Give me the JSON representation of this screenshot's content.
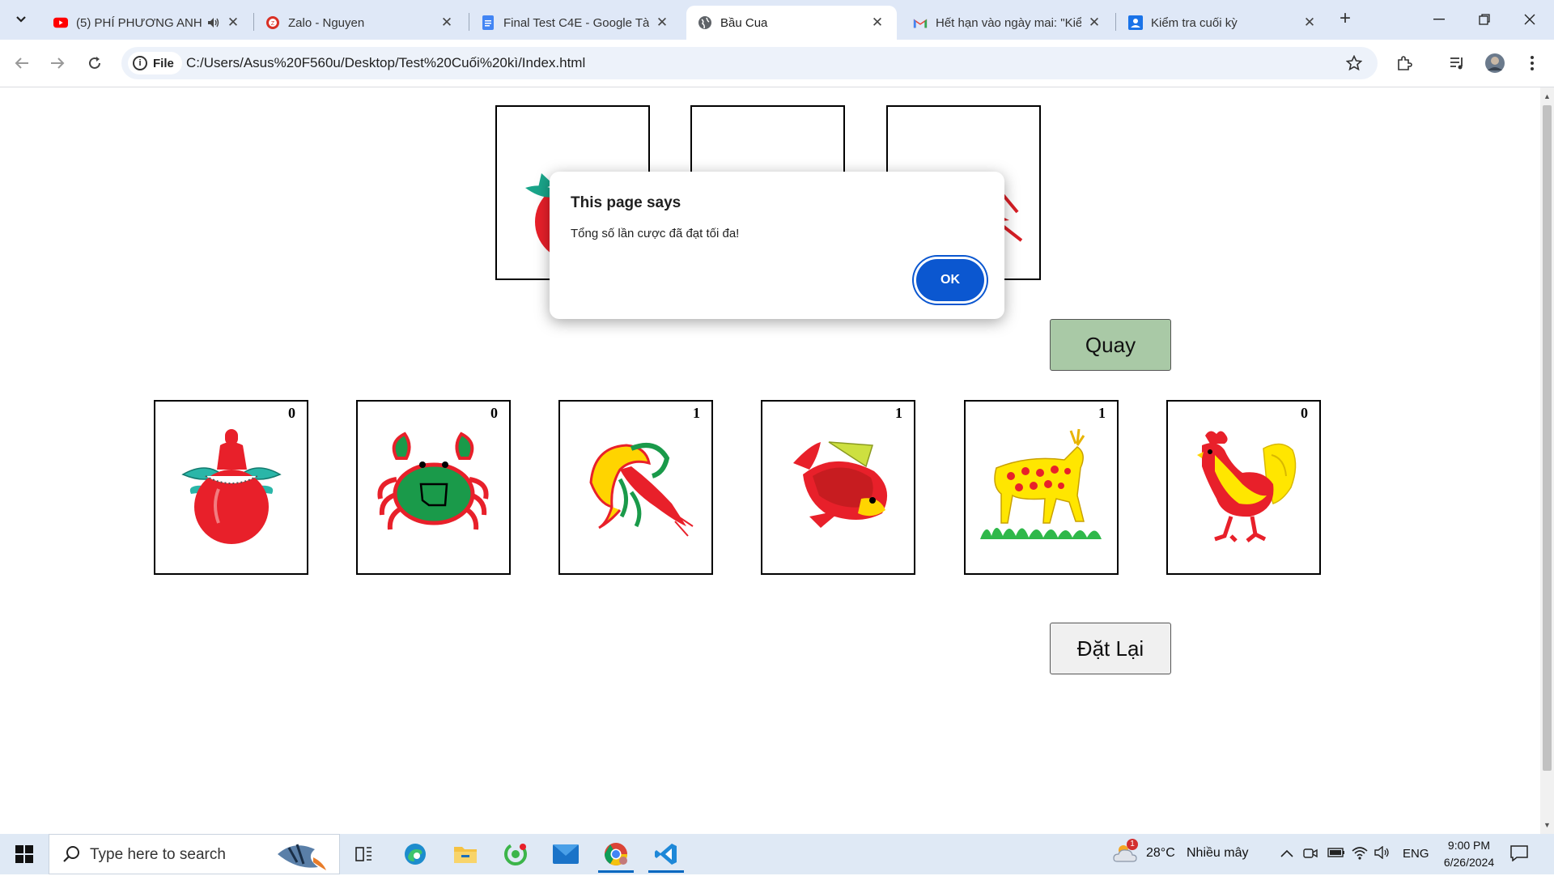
{
  "browser": {
    "tabs": [
      {
        "title": "(5) PHÍ PHƯƠNG ANH",
        "icon": "youtube-icon",
        "audio": true,
        "active": false
      },
      {
        "title": "Zalo - Nguyen",
        "icon": "zalo-icon",
        "active": false
      },
      {
        "title": "Final Test C4E - Google Tài",
        "icon": "google-docs-icon",
        "active": false
      },
      {
        "title": "Bầu Cua",
        "icon": "globe-icon",
        "active": true
      },
      {
        "title": "Hết hạn vào ngày mai: \"Kiể",
        "icon": "gmail-icon",
        "active": false
      },
      {
        "title": "Kiểm tra cuối kỳ",
        "icon": "classroom-icon",
        "active": false
      }
    ],
    "address": {
      "chip_label": "File",
      "url": "C:/Users/Asus%20F560u/Desktop/Test%20Cuối%20kì/Index.html"
    }
  },
  "page": {
    "spin_label": "Quay",
    "reset_label": "Đặt Lại",
    "bet_cards": [
      {
        "name": "bau",
        "count": "0"
      },
      {
        "name": "cua",
        "count": "0"
      },
      {
        "name": "tom",
        "count": "1"
      },
      {
        "name": "ca",
        "count": "1"
      },
      {
        "name": "nai",
        "count": "1"
      },
      {
        "name": "ga",
        "count": "0"
      }
    ]
  },
  "dialog": {
    "title": "This page says",
    "message": "Tổng số lần cược đã đạt tối đa!",
    "ok_label": "OK"
  },
  "taskbar": {
    "search_placeholder": "Type here to search",
    "weather_temp": "28°C",
    "weather_desc": "Nhiều mây",
    "weather_badge": "1",
    "language": "ENG",
    "time": "9:00 PM",
    "date": "6/26/2024"
  },
  "colors": {
    "spin_button": "#a9c9a6",
    "reset_button": "#f0f0f0",
    "dialog_ok": "#0b57d0",
    "tabbar": "#dfe8f7"
  }
}
